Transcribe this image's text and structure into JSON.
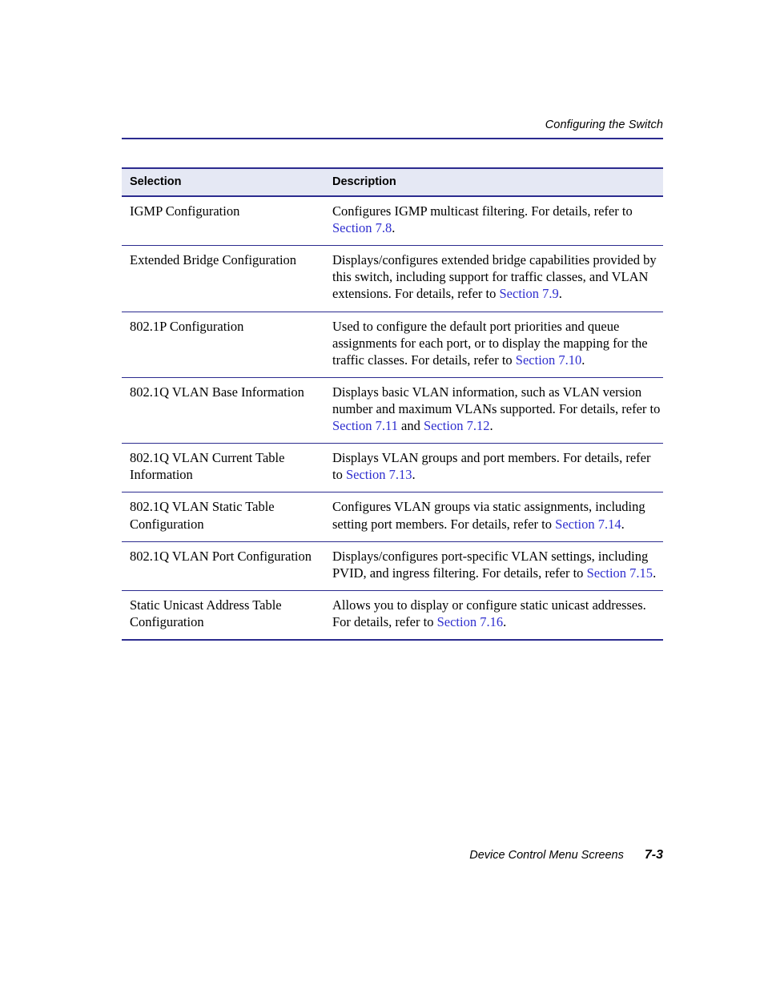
{
  "header": {
    "running_title": "Configuring the Switch"
  },
  "table": {
    "columns": [
      "Selection",
      "Description"
    ],
    "rows": [
      {
        "selection": "IGMP Configuration",
        "description_parts": [
          {
            "text": "Configures IGMP multicast filtering. For details, refer to ",
            "link": false
          },
          {
            "text": "Section 7.8",
            "link": true
          },
          {
            "text": ".",
            "link": false
          }
        ]
      },
      {
        "selection": "Extended Bridge Configuration",
        "description_parts": [
          {
            "text": "Displays/configures extended bridge capabilities provided by this switch, including support for traffic classes, and VLAN extensions. For details, refer to ",
            "link": false
          },
          {
            "text": "Section 7.9",
            "link": true
          },
          {
            "text": ".",
            "link": false
          }
        ]
      },
      {
        "selection": "802.1P Configuration",
        "description_parts": [
          {
            "text": "Used to configure the default port priorities and queue assignments for each port, or to display the mapping for the traffic classes. For details, refer to ",
            "link": false
          },
          {
            "text": "Section 7.10",
            "link": true
          },
          {
            "text": ".",
            "link": false
          }
        ]
      },
      {
        "selection": "802.1Q VLAN Base Information",
        "description_parts": [
          {
            "text": "Displays basic VLAN information, such as VLAN version number and maximum VLANs supported. For details, refer to ",
            "link": false
          },
          {
            "text": "Section 7.11",
            "link": true
          },
          {
            "text": " and ",
            "link": false
          },
          {
            "text": "Section 7.12",
            "link": true
          },
          {
            "text": ".",
            "link": false
          }
        ]
      },
      {
        "selection": "802.1Q VLAN Current Table Information",
        "description_parts": [
          {
            "text": "Displays VLAN groups and port members. For details, refer to ",
            "link": false
          },
          {
            "text": "Section 7.13",
            "link": true
          },
          {
            "text": ".",
            "link": false
          }
        ]
      },
      {
        "selection": "802.1Q VLAN Static Table Configuration",
        "description_parts": [
          {
            "text": "Configures VLAN groups via static assignments, including setting port members. For details, refer to ",
            "link": false
          },
          {
            "text": "Section 7.14",
            "link": true
          },
          {
            "text": ".",
            "link": false
          }
        ]
      },
      {
        "selection": "802.1Q VLAN Port Configuration",
        "description_parts": [
          {
            "text": "Displays/configures port-specific VLAN settings, including PVID, and ingress filtering. For details, refer to ",
            "link": false
          },
          {
            "text": "Section 7.15",
            "link": true
          },
          {
            "text": ".",
            "link": false
          }
        ]
      },
      {
        "selection": "Static Unicast Address Table Configuration",
        "description_parts": [
          {
            "text": "Allows you to display or configure static unicast addresses. For details, refer to ",
            "link": false
          },
          {
            "text": "Section 7.16",
            "link": true
          },
          {
            "text": ".",
            "link": false
          }
        ]
      }
    ]
  },
  "footer": {
    "title": "Device Control Menu Screens",
    "page_number": "7-3"
  },
  "colors": {
    "rule": "#2b2b8f",
    "header_fill": "#e5e8f4",
    "link": "#2f2fcf",
    "text": "#000000"
  }
}
